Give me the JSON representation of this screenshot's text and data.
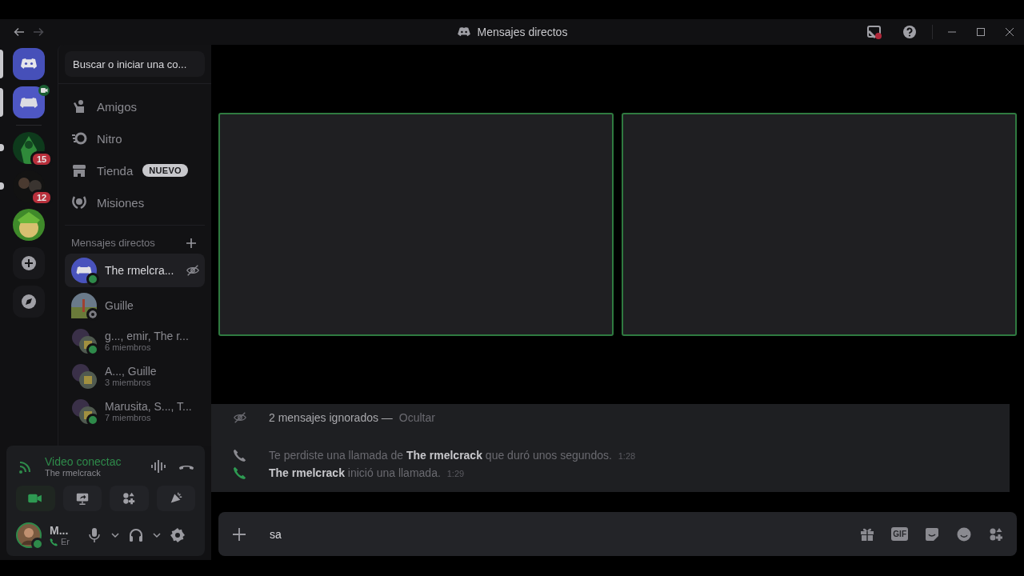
{
  "window": {
    "title": "Mensajes directos"
  },
  "search": {
    "label": "Buscar o iniciar una co..."
  },
  "guilds": [
    {
      "kind": "home",
      "active": true,
      "unread": false,
      "in_call": false
    },
    {
      "kind": "server",
      "active": true,
      "unread": false,
      "in_call": true
    },
    {
      "kind": "server",
      "active": false,
      "unread": true,
      "in_call": false,
      "badge": "15"
    },
    {
      "kind": "server",
      "active": false,
      "unread": true,
      "in_call": false,
      "badge": "12"
    },
    {
      "kind": "server",
      "active": false,
      "unread": false,
      "in_call": false
    }
  ],
  "nav": [
    {
      "kind": "friends",
      "label": "Amigos"
    },
    {
      "kind": "nitro",
      "label": "Nitro"
    },
    {
      "kind": "shop",
      "label": "Tienda",
      "tag": "NUEVO"
    },
    {
      "kind": "quests",
      "label": "Misiones"
    }
  ],
  "dm_header": {
    "title": "Mensajes directos"
  },
  "dms": [
    {
      "kind": "user",
      "name": "The rmelcra...",
      "online": true,
      "selected": true
    },
    {
      "kind": "user",
      "name": "Guille",
      "online": false,
      "selected": false
    },
    {
      "kind": "group",
      "name": "g..., emir, The r...",
      "members": "6 miembros",
      "online": true,
      "selected": false
    },
    {
      "kind": "group",
      "name": "A..., Guille",
      "members": "3 miembros",
      "online": false,
      "selected": false
    },
    {
      "kind": "group",
      "name": "Marusita, S..., T...",
      "members": "7 miembros",
      "online": true,
      "selected": false
    }
  ],
  "voice": {
    "status": "Video conectac",
    "channel": "The rmelcrack",
    "video_on": true
  },
  "user": {
    "name": "M...",
    "status": "Er"
  },
  "video_tiles": [
    {
      "speaking": true
    },
    {
      "speaking": true
    }
  ],
  "messages": [
    {
      "kind": "ignored",
      "text": "2 mensajes ignorados —",
      "action": "Ocultar"
    },
    {
      "kind": "missed",
      "text": "Te perdiste una llamada de **The rmelcrack** que duró unos segundos.",
      "time": "1:28"
    },
    {
      "kind": "call",
      "text": "**The rmelcrack** inició una llamada.",
      "time": "1:29"
    }
  ],
  "composer": {
    "value": "sa",
    "gif_label": "GIF"
  }
}
